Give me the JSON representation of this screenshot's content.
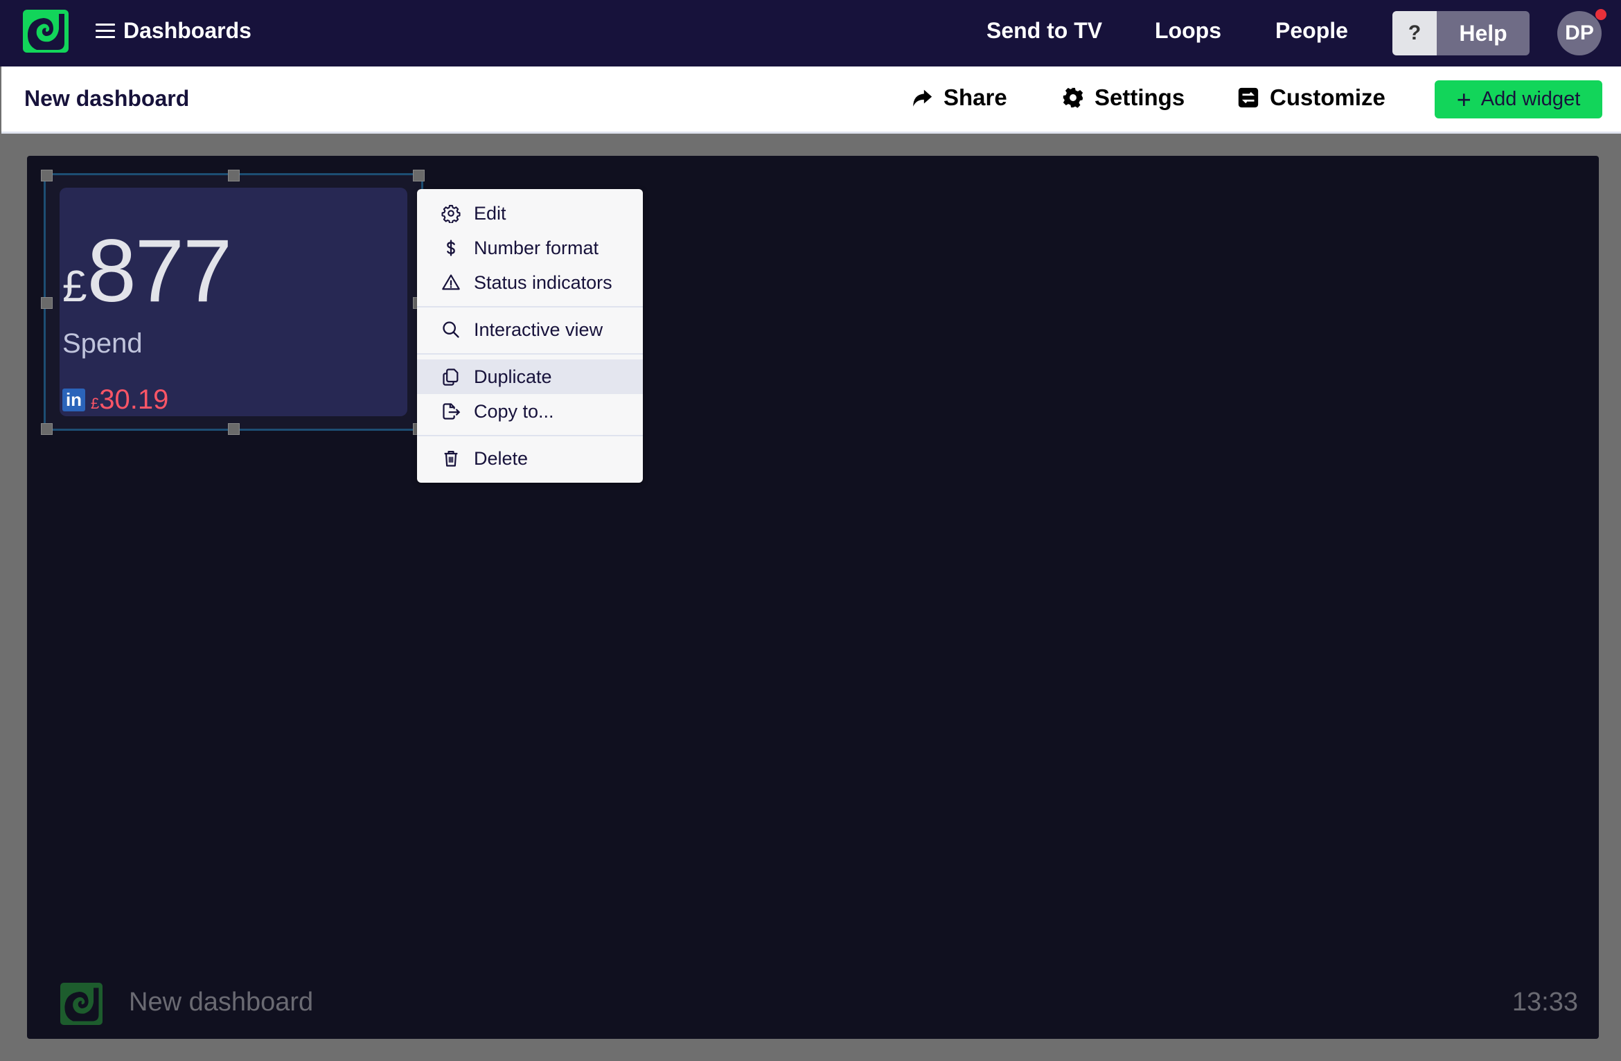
{
  "topnav": {
    "brand": "Dashboards",
    "links": [
      "Send to TV",
      "Loops",
      "People"
    ],
    "help_icon": "?",
    "help_label": "Help",
    "avatar_initials": "DP",
    "has_notification": true
  },
  "subheader": {
    "title": "New dashboard",
    "share_label": "Share",
    "settings_label": "Settings",
    "customize_label": "Customize",
    "add_widget_label": "Add widget",
    "add_widget_icon": "+"
  },
  "widget": {
    "currency": "£",
    "value": "877",
    "label": "Spend",
    "source_icon": "in",
    "source": "linkedin",
    "delta_currency": "£",
    "delta_value": "30.19",
    "delta_color": "#fa5566"
  },
  "context_menu": {
    "items": [
      {
        "label": "Edit",
        "icon": "gear-icon"
      },
      {
        "label": "Number format",
        "icon": "dollar-icon"
      },
      {
        "label": "Status indicators",
        "icon": "warning-icon"
      },
      {
        "label": "Interactive view",
        "icon": "search-icon"
      },
      {
        "label": "Duplicate",
        "icon": "duplicate-icon",
        "hovered": true
      },
      {
        "label": "Copy to...",
        "icon": "copy-to-icon"
      },
      {
        "label": "Delete",
        "icon": "trash-icon"
      }
    ]
  },
  "footer": {
    "title": "New dashboard",
    "time": "13:33"
  },
  "colors": {
    "nav_bg": "#17123b",
    "accent_green": "#12d55a",
    "canvas_bg": "#10101f",
    "widget_bg": "#272853",
    "negative": "#fa5566"
  }
}
